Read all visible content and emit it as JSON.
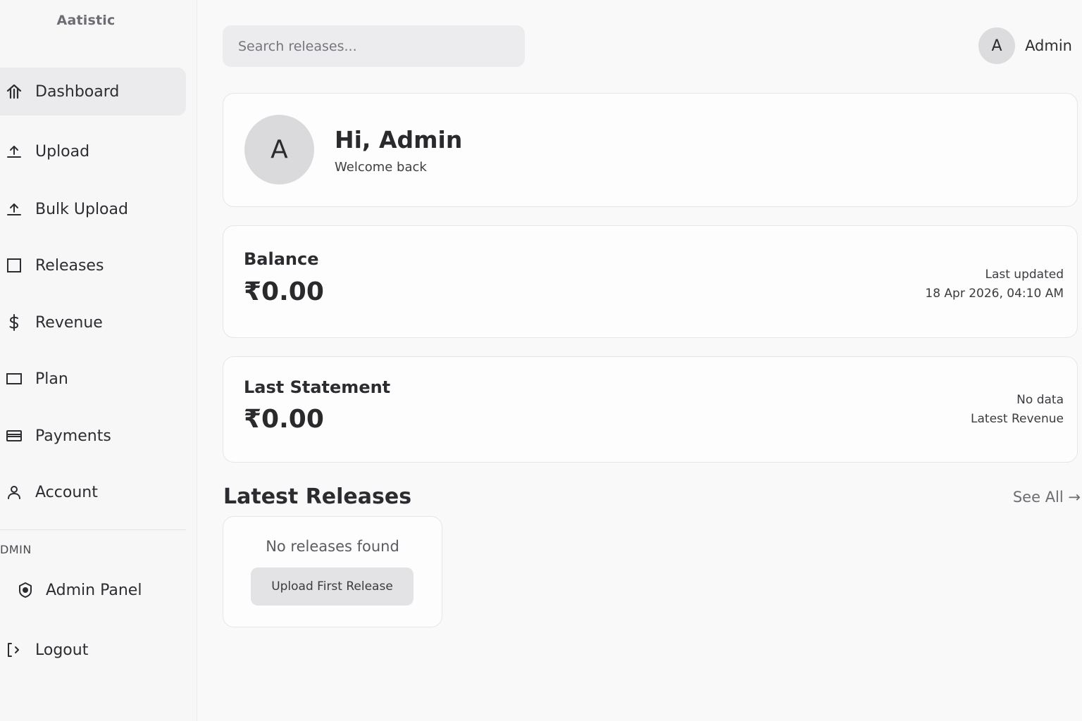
{
  "brand": "Aatistic",
  "sidebar": {
    "items": [
      {
        "label": "Dashboard",
        "icon": "home-icon"
      },
      {
        "label": "Upload",
        "icon": "upload-icon"
      },
      {
        "label": "Bulk Upload",
        "icon": "upload-icon"
      },
      {
        "label": "Releases",
        "icon": "square-icon"
      },
      {
        "label": "Revenue",
        "icon": "dollar-icon"
      },
      {
        "label": "Plan",
        "icon": "rectangle-icon"
      },
      {
        "label": "Payments",
        "icon": "card-icon"
      },
      {
        "label": "Account",
        "icon": "user-icon"
      }
    ],
    "section_label": "DMIN",
    "admin_items": [
      {
        "label": "Admin Panel",
        "icon": "shield-icon"
      },
      {
        "label": "Logout",
        "icon": "logout-icon"
      }
    ]
  },
  "header": {
    "search_placeholder": "Search releases...",
    "user_initial": "A",
    "user_name": "Admin"
  },
  "greeting": {
    "initial": "A",
    "title": "Hi, Admin",
    "subtitle": "Welcome back"
  },
  "balance": {
    "title": "Balance",
    "amount": "₹0.00",
    "meta_label": "Last updated",
    "meta_value": "18 Apr 2026, 04:10 AM"
  },
  "statement": {
    "title": "Last Statement",
    "amount": "₹0.00",
    "meta_label": "No data",
    "meta_value": "Latest Revenue"
  },
  "releases": {
    "title": "Latest Releases",
    "see_all": "See All →",
    "empty_text": "No releases found",
    "empty_button": "Upload First Release"
  },
  "colors": {
    "background": "#f9f9fa",
    "active_nav": "#ebebee",
    "card": "#fdfdfd",
    "avatar": "#dadadd"
  }
}
